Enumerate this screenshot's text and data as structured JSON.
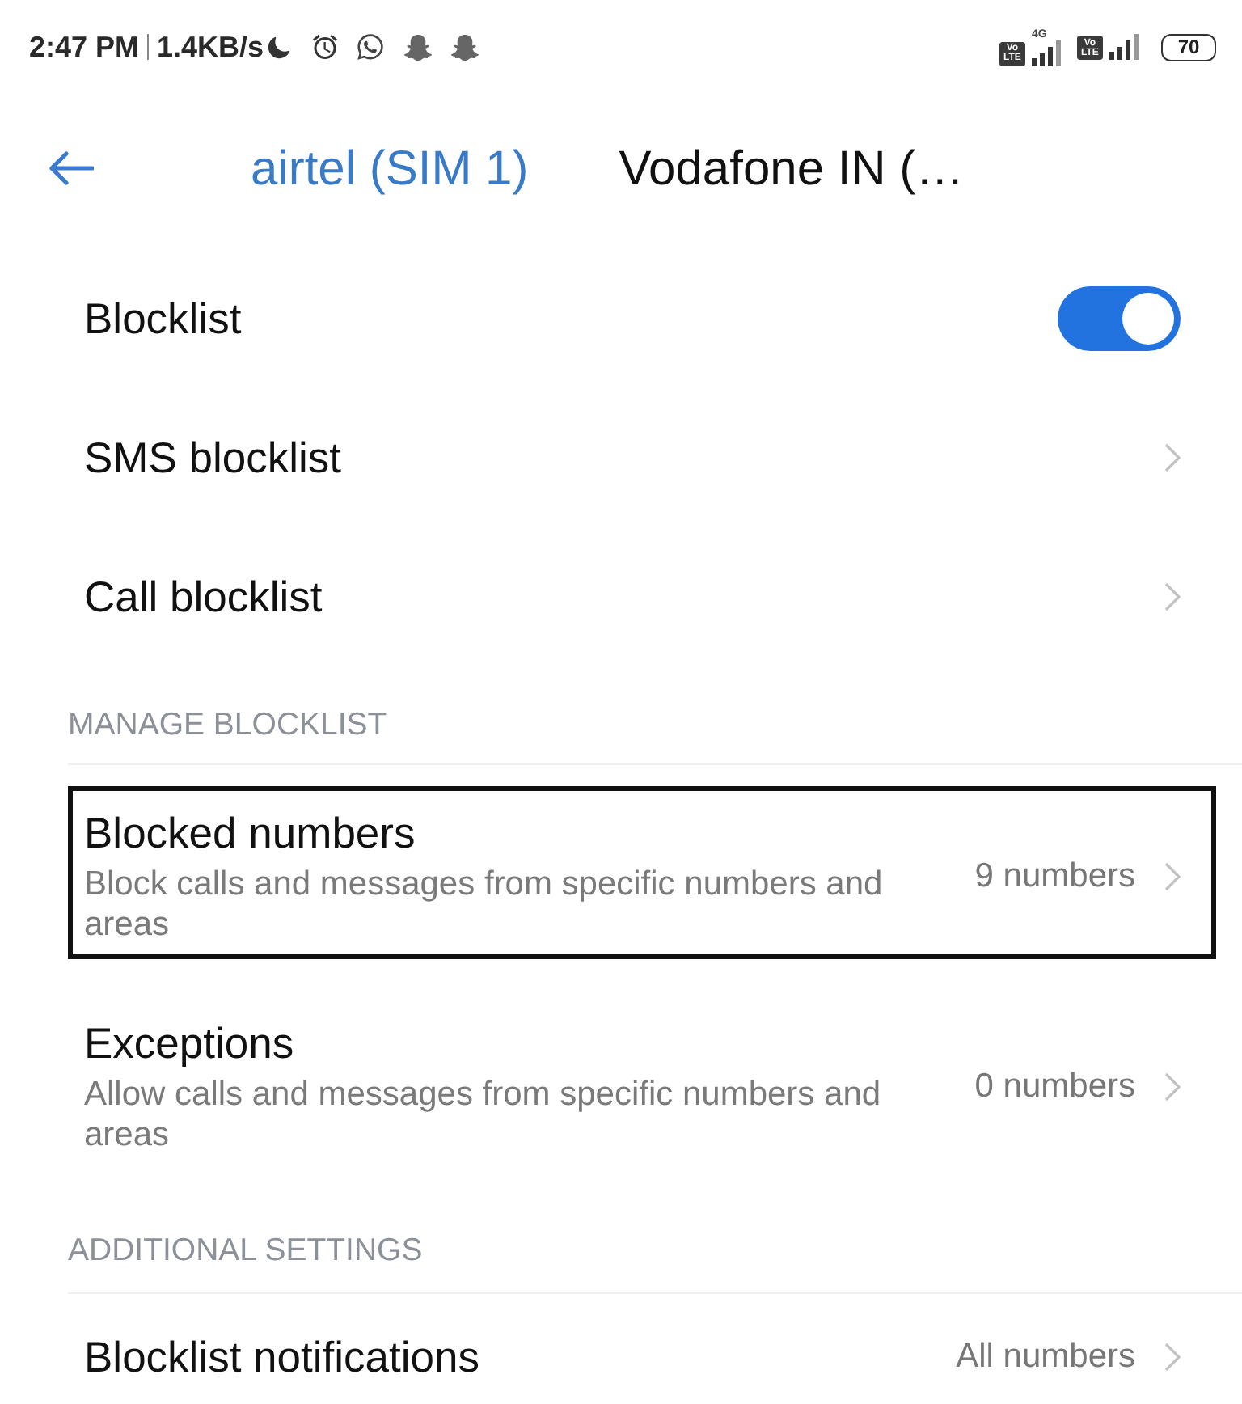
{
  "status_bar": {
    "time": "2:47 PM",
    "speed": "1.4KB/s",
    "sims": [
      {
        "badge_top": "Vo",
        "badge_bottom": "LTE",
        "network": "4G"
      },
      {
        "badge_top": "Vo",
        "badge_bottom": "LTE"
      }
    ],
    "battery": "70"
  },
  "header": {
    "tabs": [
      {
        "label": "airtel (SIM 1)",
        "selected": true
      },
      {
        "label": "Vodafone IN (…",
        "selected": false
      }
    ]
  },
  "sections": [
    {
      "items": [
        {
          "kind": "toggle",
          "title": "Blocklist",
          "on": true
        },
        {
          "kind": "link",
          "title": "SMS blocklist"
        },
        {
          "kind": "link",
          "title": "Call blocklist"
        }
      ]
    },
    {
      "heading": "MANAGE BLOCKLIST",
      "items": [
        {
          "kind": "link",
          "title": "Blocked numbers",
          "subtitle": "Block calls and messages from specific numbers and areas",
          "value": "9 numbers",
          "highlighted": true
        },
        {
          "kind": "link",
          "title": "Exceptions",
          "subtitle": "Allow calls and messages from specific numbers and areas",
          "value": "0 numbers",
          "highlighted": false
        }
      ]
    },
    {
      "heading": "ADDITIONAL SETTINGS",
      "items": [
        {
          "kind": "link",
          "title": "Blocklist notifications",
          "value": "All numbers"
        }
      ]
    }
  ]
}
